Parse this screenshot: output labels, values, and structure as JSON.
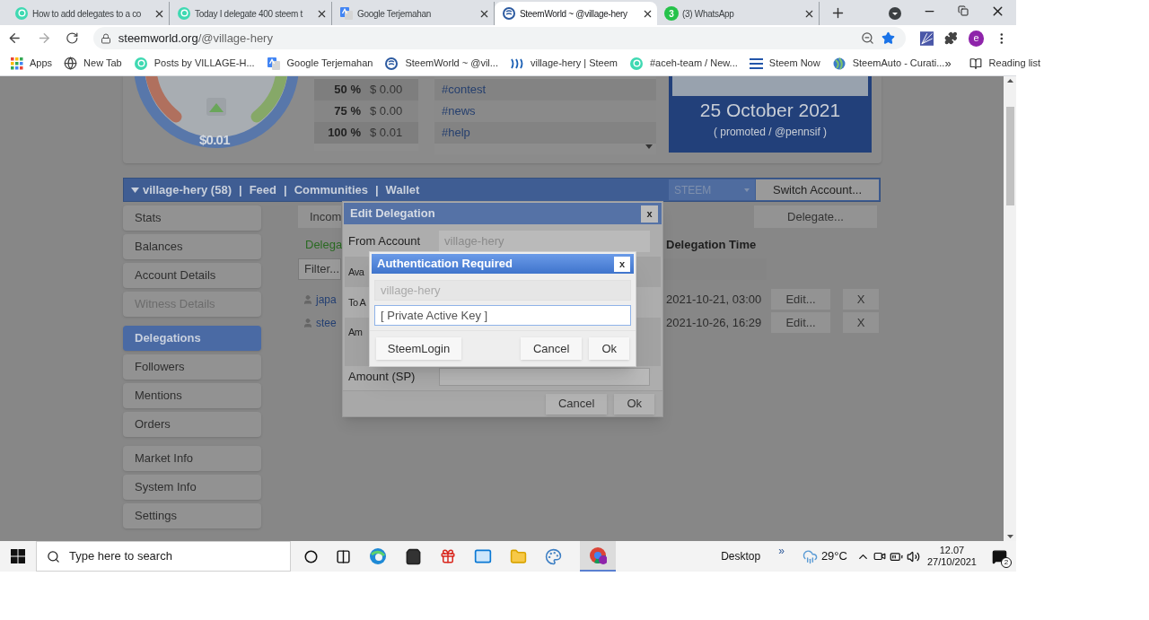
{
  "browser": {
    "tabs": [
      {
        "title": "How to add delegates to a co",
        "kind": "steemit",
        "selected": false
      },
      {
        "title": "Today I delegate 400 steem t",
        "kind": "steemit",
        "selected": false
      },
      {
        "title": "Google Terjemahan",
        "kind": "translate",
        "selected": false
      },
      {
        "title": "SteemWorld ~ @village-hery",
        "kind": "steemworld",
        "selected": true
      },
      {
        "title": "(3) WhatsApp",
        "kind": "whatsapp",
        "badge": "3",
        "selected": false
      }
    ],
    "address": {
      "host": "steemworld.org",
      "path": "/@village-hery"
    },
    "profile_initial": "e",
    "bookmarks": [
      {
        "label": "Apps",
        "kind": "apps"
      },
      {
        "label": "New Tab",
        "kind": "globe"
      },
      {
        "label": "Posts by VILLAGE-H...",
        "kind": "steemit"
      },
      {
        "label": "Google Terjemahan",
        "kind": "translate"
      },
      {
        "label": "SteemWorld ~ @vil...",
        "kind": "steemworld"
      },
      {
        "label": "village-hery | Steem",
        "kind": "steem"
      },
      {
        "label": "#aceh-team / New...",
        "kind": "steemit"
      },
      {
        "label": "Steem Now",
        "kind": "lines"
      },
      {
        "label": "SteemAuto - Curati...",
        "kind": "steemauto"
      }
    ],
    "bookmarks_overflow": "»",
    "reading_list": "Reading list"
  },
  "page": {
    "gauge": {
      "value": "$0.01"
    },
    "vote_table": [
      {
        "percent": "50 %",
        "value": "$ 0.00"
      },
      {
        "percent": "75 %",
        "value": "$ 0.00"
      },
      {
        "percent": "100 %",
        "value": "$ 0.01"
      }
    ],
    "tags": [
      "#contest",
      "#news",
      "#help"
    ],
    "promo": {
      "date": "25 October 2021",
      "note": "( promoted / @pennsif )"
    },
    "nav": {
      "account": "village-hery (58)",
      "links": [
        "Feed",
        "Communities",
        "Wallet"
      ],
      "separator": "|",
      "currency": "STEEM",
      "switch_button": "Switch Account..."
    },
    "sidebar": {
      "groups": [
        {
          "items": [
            {
              "label": "Stats",
              "selected": false,
              "disabled": false
            },
            {
              "label": "Balances",
              "selected": false,
              "disabled": false
            },
            {
              "label": "Account Details",
              "selected": false,
              "disabled": false
            },
            {
              "label": "Witness Details",
              "selected": false,
              "disabled": true
            }
          ]
        },
        {
          "items": [
            {
              "label": "Delegations",
              "selected": true,
              "disabled": false
            },
            {
              "label": "Followers",
              "selected": false,
              "disabled": false
            },
            {
              "label": "Mentions",
              "selected": false,
              "disabled": false
            },
            {
              "label": "Orders",
              "selected": false,
              "disabled": false
            }
          ]
        },
        {
          "items": [
            {
              "label": "Market Info",
              "selected": false,
              "disabled": false
            },
            {
              "label": "System Info",
              "selected": false,
              "disabled": false
            },
            {
              "label": "Settings",
              "selected": false,
              "disabled": false
            }
          ]
        }
      ]
    },
    "main": {
      "tab_fragment": "Incom",
      "delegate_button": "Delegate...",
      "heading_fragment": "Delega",
      "time_column": "Delegation Time",
      "filter_placeholder": "Filter...",
      "rows": [
        {
          "name_fragment": "japa",
          "time": "2021-10-21, 03:00",
          "edit": "Edit...",
          "remove": "X"
        },
        {
          "name_fragment": "stee",
          "time": "2021-10-26, 16:29",
          "edit": "Edit...",
          "remove": "X"
        }
      ]
    }
  },
  "edit_dialog": {
    "title": "Edit Delegation",
    "close": "x",
    "fields": [
      {
        "label": "From Account",
        "value": "village-hery"
      },
      {
        "label": "Ava"
      },
      {
        "label": "To A"
      },
      {
        "label": "Am"
      },
      {
        "label": "Amount (SP)"
      }
    ],
    "buttons": [
      "Cancel",
      "Ok"
    ]
  },
  "auth_dialog": {
    "title": "Authentication Required",
    "close": "x",
    "account": "village-hery",
    "key_placeholder": "[ Private Active Key ]",
    "login_button": "SteemLogin",
    "buttons": [
      "Cancel",
      "Ok"
    ]
  },
  "taskbar": {
    "search_placeholder": "Type here to search",
    "desktop": "Desktop",
    "chevron": "»",
    "temperature": "29°C",
    "time": "12.07",
    "date": "27/10/2021",
    "notifications": "2"
  }
}
